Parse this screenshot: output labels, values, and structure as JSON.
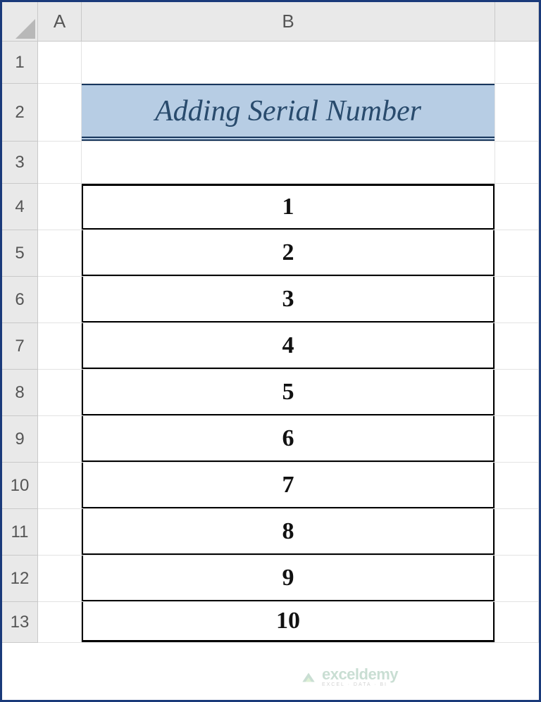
{
  "columns": {
    "corner": "",
    "A": "A",
    "B": "B",
    "C": ""
  },
  "rowLabels": [
    "1",
    "2",
    "3",
    "4",
    "5",
    "6",
    "7",
    "8",
    "9",
    "10",
    "11",
    "12",
    "13"
  ],
  "title": "Adding Serial Number",
  "serials": [
    "1",
    "2",
    "3",
    "4",
    "5",
    "6",
    "7",
    "8",
    "9",
    "10"
  ],
  "watermark": {
    "main": "exceldemy",
    "sub": "EXCEL · DATA · BI"
  }
}
